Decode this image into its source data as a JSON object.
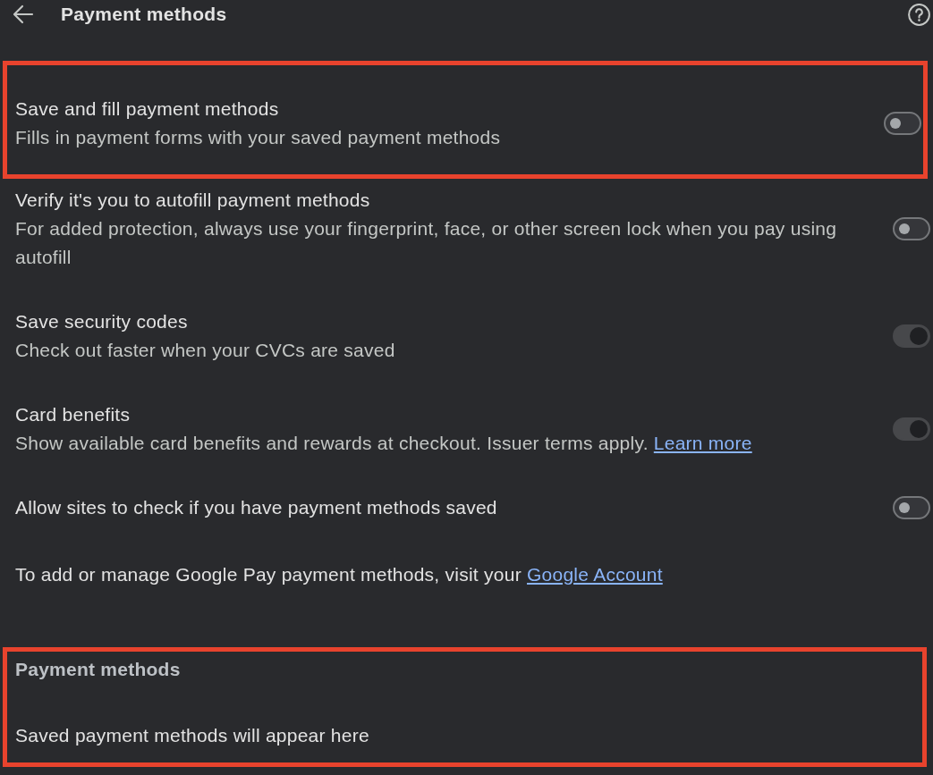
{
  "header": {
    "title": "Payment methods"
  },
  "settings": [
    {
      "title": "Save and fill payment methods",
      "description": "Fills in payment forms with your saved payment methods",
      "on": false,
      "disabled": false,
      "highlighted": true
    },
    {
      "title": "Verify it's you to autofill payment methods",
      "description": "For added protection, always use your fingerprint, face, or other screen lock when you pay using autofill",
      "on": false,
      "disabled": false,
      "highlighted": false
    },
    {
      "title": "Save security codes",
      "description": "Check out faster when your CVCs are saved",
      "on": true,
      "disabled": true,
      "highlighted": false
    },
    {
      "title": "Card benefits",
      "description": "Show available card benefits and rewards at checkout. Issuer terms apply.",
      "link": "Learn more",
      "on": true,
      "disabled": true,
      "highlighted": false
    },
    {
      "title": "Allow sites to check if you have payment methods saved",
      "on": false,
      "disabled": false,
      "highlighted": false
    }
  ],
  "note": {
    "text": "To add or manage Google Pay payment methods, visit your",
    "link": "Google Account"
  },
  "payment_methods": {
    "heading": "Payment methods",
    "empty_text": "Saved payment methods will appear here",
    "highlighted": true
  }
}
